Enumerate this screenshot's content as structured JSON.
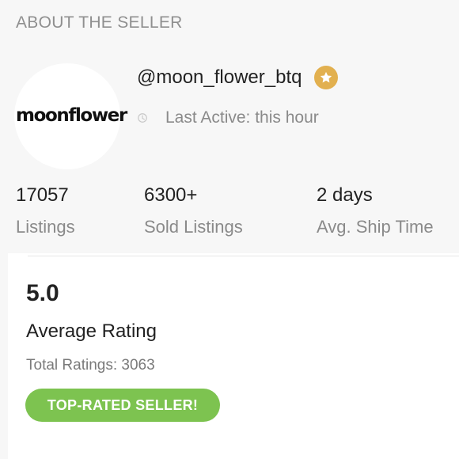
{
  "section": {
    "heading": "ABOUT THE SELLER"
  },
  "seller": {
    "logo_text": "moonflower",
    "username": "@moon_flower_btq",
    "badge_icon": "star-icon",
    "last_active": "Last Active: this hour"
  },
  "stats": [
    {
      "value": "17057",
      "label": "Listings"
    },
    {
      "value": "6300+",
      "label": "Sold Listings"
    },
    {
      "value": "2 days",
      "label": "Avg. Ship Time"
    }
  ],
  "rating": {
    "value": "5.0",
    "title": "Average Rating",
    "total": "Total Ratings: 3063",
    "badge": "TOP-RATED SELLER!"
  },
  "colors": {
    "background": "#f7f7f7",
    "card": "#ffffff",
    "accent_gold": "#e2b04f",
    "badge_green": "#7dc350"
  }
}
